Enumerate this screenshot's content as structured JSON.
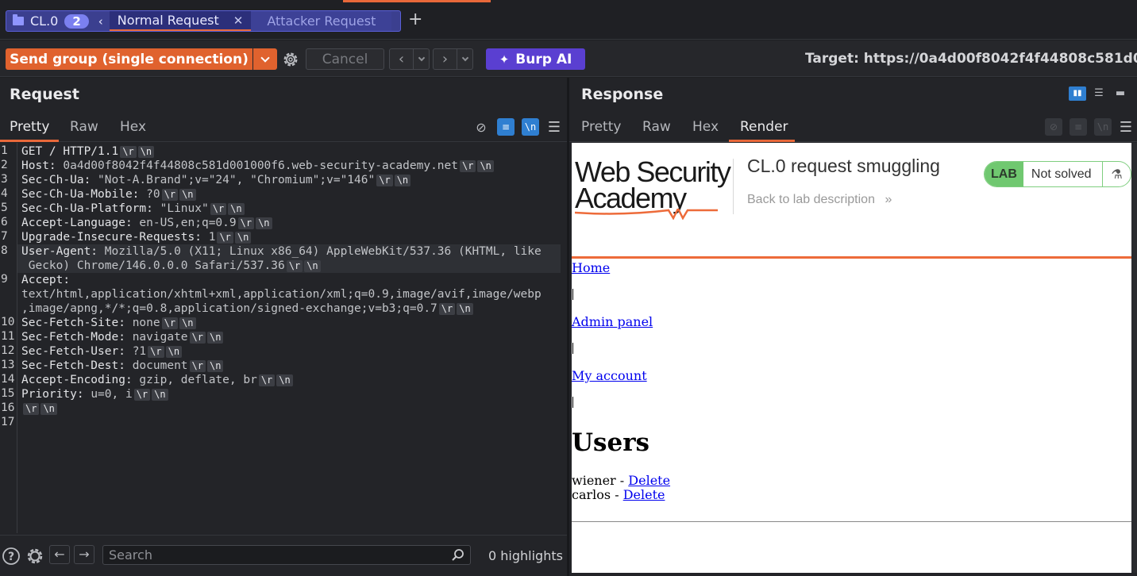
{
  "tabs": {
    "group_label": "CL.0",
    "group_count": "2",
    "active_tab": "Normal Request",
    "inactive_tab": "Attacker Request",
    "add": "+"
  },
  "toolbar": {
    "send_label": "Send group (single connection)",
    "cancel_label": "Cancel",
    "burp_ai_label": "Burp AI",
    "target": "Target: https://0a4d00f8042f4f44808c581d001"
  },
  "request": {
    "title": "Request",
    "tabs": [
      "Pretty",
      "Raw",
      "Hex"
    ],
    "lines": [
      {
        "n": "1",
        "k": "GET / HTTP/1.1",
        "v": ""
      },
      {
        "n": "2",
        "k": "Host: ",
        "v": "0a4d00f8042f4f44808c581d001000f6.web-security-academy.net"
      },
      {
        "n": "3",
        "k": "Sec-Ch-Ua: ",
        "v": "\"Not-A.Brand\";v=\"24\", \"Chromium\";v=\"146\""
      },
      {
        "n": "4",
        "k": "Sec-Ch-Ua-Mobile: ",
        "v": "?0"
      },
      {
        "n": "5",
        "k": "Sec-Ch-Ua-Platform: ",
        "v": "\"Linux\""
      },
      {
        "n": "6",
        "k": "Accept-Language: ",
        "v": "en-US,en;q=0.9"
      },
      {
        "n": "7",
        "k": "Upgrade-Insecure-Requests: ",
        "v": "1"
      },
      {
        "n": "8",
        "k": "User-Agent: ",
        "v": "Mozilla/5.0 (X11; Linux x86_64) AppleWebKit/537.36 (KHTML, like"
      },
      {
        "n": "",
        "k": "",
        "v": " Gecko) Chrome/146.0.0.0 Safari/537.36"
      },
      {
        "n": "9",
        "k": "Accept: ",
        "v": ""
      },
      {
        "n": "",
        "k": "",
        "v": "text/html,application/xhtml+xml,application/xml;q=0.9,image/avif,image/webp"
      },
      {
        "n": "",
        "k": "",
        "v": ",image/apng,*/*;q=0.8,application/signed-exchange;v=b3;q=0.7"
      },
      {
        "n": "10",
        "k": "Sec-Fetch-Site: ",
        "v": "none"
      },
      {
        "n": "11",
        "k": "Sec-Fetch-Mode: ",
        "v": "navigate"
      },
      {
        "n": "12",
        "k": "Sec-Fetch-User: ",
        "v": "?1"
      },
      {
        "n": "13",
        "k": "Sec-Fetch-Dest: ",
        "v": "document"
      },
      {
        "n": "14",
        "k": "Accept-Encoding: ",
        "v": "gzip, deflate, br"
      },
      {
        "n": "15",
        "k": "Priority: ",
        "v": "u=0, i"
      },
      {
        "n": "16",
        "k": "",
        "v": ""
      },
      {
        "n": "17",
        "k": "",
        "v": ""
      }
    ],
    "crlf_r": "\\r",
    "crlf_n": "\\n",
    "nl_toggle": "\\n",
    "search_placeholder": "Search",
    "highlights": "0 highlights"
  },
  "response": {
    "title": "Response",
    "tabs": [
      "Pretty",
      "Raw",
      "Hex",
      "Render"
    ],
    "nl_toggle": "\\n",
    "render": {
      "logo_line1": "Web Security",
      "logo_line2": "Academy",
      "lab_title": "CL.0 request smuggling",
      "back_link": "Back to lab description",
      "back_arrows": "»",
      "badge_lab": "LAB",
      "badge_status": "Not solved",
      "flask": "⚗",
      "nav": [
        "Home",
        "Admin panel",
        "My account"
      ],
      "users_heading": "Users",
      "users": [
        {
          "name": "wiener - ",
          "action": "Delete"
        },
        {
          "name": "carlos - ",
          "action": "Delete"
        }
      ]
    }
  },
  "colors": {
    "accent": "#e8683a",
    "send": "#e0622e",
    "burp_ai": "#5a3fd1",
    "tab_group": "#3b3f8f",
    "lab_green": "#70c870"
  }
}
